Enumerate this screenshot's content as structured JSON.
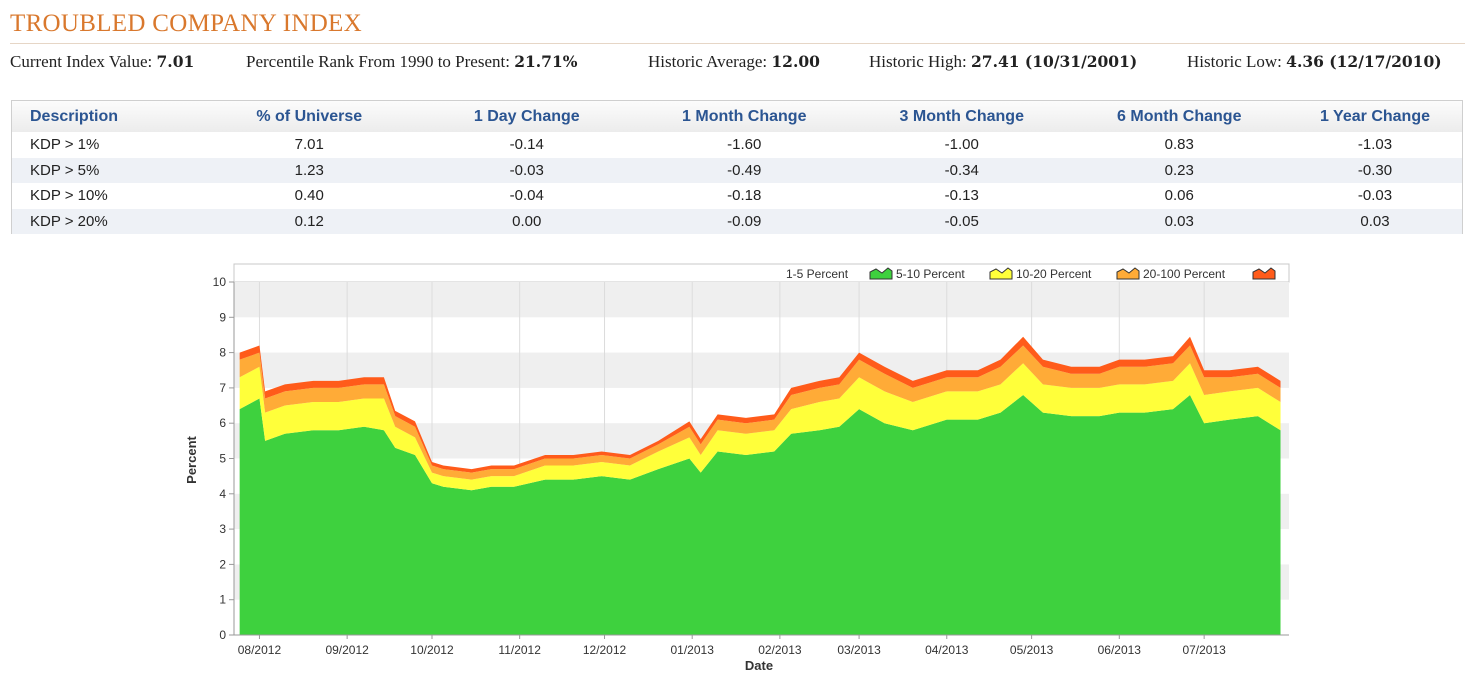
{
  "header": {
    "title": "TROUBLED COMPANY INDEX"
  },
  "stats": {
    "current_label": "Current Index Value:",
    "current_value": "7.01",
    "percentile_label": "Percentile Rank From 1990 to Present:",
    "percentile_value": "21.71%",
    "average_label": "Historic Average:",
    "average_value": "12.00",
    "high_label": "Historic High:",
    "high_value": "27.41 (10/31/2001)",
    "low_label": "Historic Low:",
    "low_value": "4.36 (12/17/2010)"
  },
  "table": {
    "columns": [
      "Description",
      "% of Universe",
      "1 Day Change",
      "1 Month Change",
      "3 Month Change",
      "6 Month Change",
      "1 Year Change"
    ],
    "rows": [
      [
        "KDP > 1%",
        "7.01",
        "-0.14",
        "-1.60",
        "-1.00",
        "0.83",
        "-1.03"
      ],
      [
        "KDP > 5%",
        "1.23",
        "-0.03",
        "-0.49",
        "-0.34",
        "0.23",
        "-0.30"
      ],
      [
        "KDP > 10%",
        "0.40",
        "-0.04",
        "-0.18",
        "-0.13",
        "0.06",
        "-0.03"
      ],
      [
        "KDP > 20%",
        "0.12",
        "0.00",
        "-0.09",
        "-0.05",
        "0.03",
        "0.03"
      ]
    ]
  },
  "chart_data": {
    "type": "area",
    "stacked": true,
    "xlabel": "Date",
    "ylabel": "Percent",
    "ylim": [
      0,
      10
    ],
    "yticks": [
      0,
      1,
      2,
      3,
      4,
      5,
      6,
      7,
      8,
      9,
      10
    ],
    "xticks": [
      "08/2012",
      "09/2012",
      "10/2012",
      "11/2012",
      "12/2012",
      "01/2013",
      "02/2013",
      "03/2013",
      "04/2013",
      "05/2013",
      "06/2013",
      "07/2013"
    ],
    "legend_position": "top-right",
    "grid": true,
    "x": [
      "2012-07-25",
      "2012-08-01",
      "2012-08-03",
      "2012-08-10",
      "2012-08-20",
      "2012-08-29",
      "2012-09-07",
      "2012-09-14",
      "2012-09-18",
      "2012-09-25",
      "2012-10-01",
      "2012-10-05",
      "2012-10-15",
      "2012-10-22",
      "2012-10-30",
      "2012-11-10",
      "2012-11-20",
      "2012-11-30",
      "2012-12-10",
      "2012-12-20",
      "2012-12-31",
      "2013-01-04",
      "2013-01-10",
      "2013-01-20",
      "2013-01-30",
      "2013-02-05",
      "2013-02-15",
      "2013-02-22",
      "2013-03-01",
      "2013-03-10",
      "2013-03-20",
      "2013-04-01",
      "2013-04-12",
      "2013-04-20",
      "2013-04-28",
      "2013-05-05",
      "2013-05-15",
      "2013-05-25",
      "2013-06-01",
      "2013-06-10",
      "2013-06-20",
      "2013-06-26",
      "2013-07-01",
      "2013-07-10",
      "2013-07-20",
      "2013-07-28"
    ],
    "series": [
      {
        "name": "1-5 Percent",
        "color": "#3ed13e",
        "values": [
          6.4,
          6.7,
          5.5,
          5.7,
          5.8,
          5.8,
          5.9,
          5.8,
          5.3,
          5.1,
          4.3,
          4.2,
          4.1,
          4.2,
          4.2,
          4.4,
          4.4,
          4.5,
          4.4,
          4.7,
          5.0,
          4.6,
          5.2,
          5.1,
          5.2,
          5.7,
          5.8,
          5.9,
          6.4,
          6.0,
          5.8,
          6.1,
          6.1,
          6.3,
          6.8,
          6.3,
          6.2,
          6.2,
          6.3,
          6.3,
          6.4,
          6.8,
          6.0,
          6.1,
          6.2,
          5.8
        ]
      },
      {
        "name": "5-10 Percent",
        "color": "#ffff3a",
        "values": [
          0.9,
          0.9,
          0.8,
          0.8,
          0.8,
          0.8,
          0.8,
          0.9,
          0.6,
          0.5,
          0.3,
          0.3,
          0.3,
          0.3,
          0.3,
          0.4,
          0.4,
          0.4,
          0.4,
          0.5,
          0.6,
          0.5,
          0.6,
          0.6,
          0.6,
          0.7,
          0.8,
          0.8,
          0.9,
          0.9,
          0.8,
          0.8,
          0.8,
          0.8,
          0.9,
          0.8,
          0.8,
          0.8,
          0.8,
          0.8,
          0.8,
          0.9,
          0.8,
          0.8,
          0.8,
          0.8
        ]
      },
      {
        "name": "10-20 Percent",
        "color": "#ffab37",
        "values": [
          0.5,
          0.4,
          0.4,
          0.4,
          0.4,
          0.4,
          0.4,
          0.4,
          0.3,
          0.3,
          0.2,
          0.2,
          0.2,
          0.2,
          0.2,
          0.2,
          0.2,
          0.2,
          0.2,
          0.2,
          0.3,
          0.3,
          0.3,
          0.3,
          0.3,
          0.4,
          0.4,
          0.4,
          0.5,
          0.5,
          0.4,
          0.4,
          0.4,
          0.5,
          0.5,
          0.5,
          0.4,
          0.4,
          0.5,
          0.5,
          0.5,
          0.5,
          0.5,
          0.4,
          0.4,
          0.4
        ]
      },
      {
        "name": "20-100 Percent",
        "color": "#ff5b1a",
        "values": [
          0.2,
          0.2,
          0.2,
          0.2,
          0.2,
          0.2,
          0.2,
          0.2,
          0.15,
          0.15,
          0.1,
          0.1,
          0.1,
          0.1,
          0.1,
          0.1,
          0.1,
          0.1,
          0.1,
          0.1,
          0.15,
          0.15,
          0.15,
          0.15,
          0.15,
          0.2,
          0.2,
          0.2,
          0.2,
          0.2,
          0.2,
          0.2,
          0.2,
          0.2,
          0.25,
          0.2,
          0.2,
          0.2,
          0.2,
          0.2,
          0.2,
          0.25,
          0.2,
          0.2,
          0.2,
          0.2
        ]
      }
    ]
  }
}
